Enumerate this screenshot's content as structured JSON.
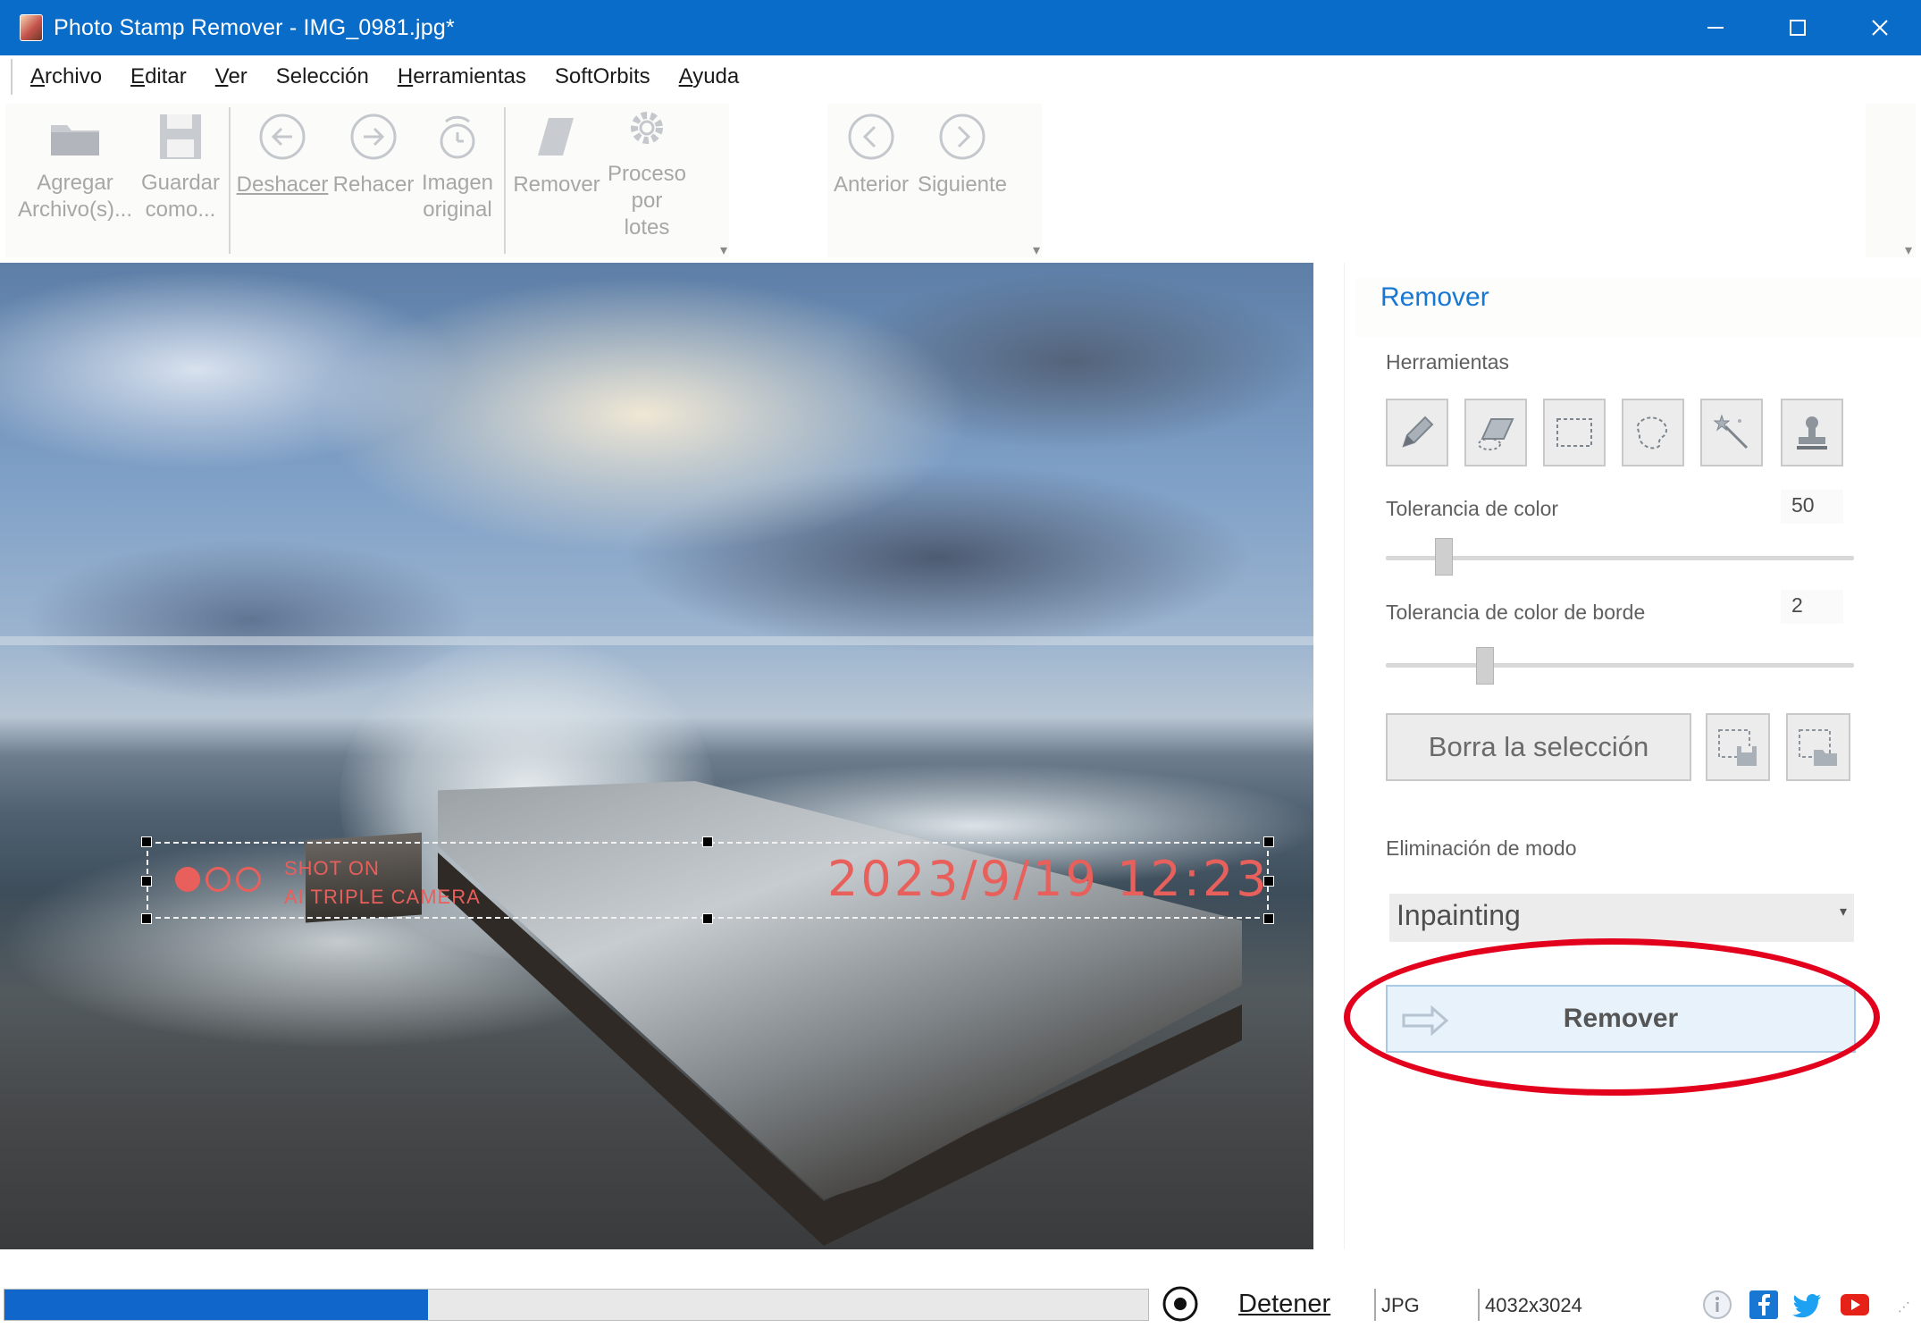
{
  "window": {
    "title": "Photo Stamp Remover - IMG_0981.jpg*",
    "controls": {
      "minimize": "minimize-icon",
      "maximize": "maximize-icon",
      "close": "close-icon"
    }
  },
  "menu": {
    "items": [
      {
        "label": "Archivo",
        "accel": "A"
      },
      {
        "label": "Editar",
        "accel": "E"
      },
      {
        "label": "Ver",
        "accel": "V"
      },
      {
        "label": "Selección",
        "accel": ""
      },
      {
        "label": "Herramientas",
        "accel": "H"
      },
      {
        "label": "SoftOrbits",
        "accel": ""
      },
      {
        "label": "Ayuda",
        "accel": "A"
      }
    ]
  },
  "toolbar": {
    "add_files": {
      "line1": "Agregar",
      "line2": "Archivo(s)...",
      "icon": "folder-icon"
    },
    "save_as": {
      "line1": "Guardar",
      "line2": "como...",
      "icon": "save-icon"
    },
    "undo": {
      "label": "Deshacer",
      "icon": "undo-icon"
    },
    "redo": {
      "label": "Rehacer",
      "icon": "redo-icon"
    },
    "original": {
      "line1": "Imagen",
      "line2": "original",
      "icon": "original-image-icon"
    },
    "remove": {
      "label": "Remover",
      "icon": "eraser-icon"
    },
    "batch": {
      "line1": "Proceso",
      "line2": "por",
      "line3": "lotes",
      "icon": "gear-icon"
    },
    "previous": {
      "label": "Anterior",
      "icon": "previous-icon"
    },
    "next": {
      "label": "Siguiente",
      "icon": "next-icon"
    }
  },
  "canvas": {
    "stamp_line1": "SHOT ON",
    "stamp_line2": "AI TRIPLE CAMERA",
    "stamp_date": "2023/9/19  12:23"
  },
  "panel": {
    "title": "Remover",
    "tools_label": "Herramientas",
    "tools": [
      "pencil-icon",
      "eraser-tool-icon",
      "rect-select-icon",
      "lasso-icon",
      "magic-wand-icon",
      "stamp-icon"
    ],
    "color_tolerance": {
      "label": "Tolerancia de color",
      "value": "50",
      "level": 0.11
    },
    "border_tolerance": {
      "label": "Tolerancia de color de borde",
      "value": "2",
      "level": 0.2
    },
    "clear_selection": "Borra la selección",
    "save_selection_icon": "save-selection-icon",
    "load_selection_icon": "load-selection-icon",
    "mode_label": "Eliminación de modo",
    "mode_value": "Inpainting",
    "remove_button": "Remover"
  },
  "status": {
    "progress": 0.37,
    "stop_label": "Detener",
    "format": "JPG",
    "dimensions": "4032x3024"
  },
  "colors": {
    "titlebar": "#0a6cc9",
    "accent": "#1877d2",
    "progress": "#1066cb",
    "highlight": "#e2001d",
    "stamp": "#e85f5c"
  }
}
